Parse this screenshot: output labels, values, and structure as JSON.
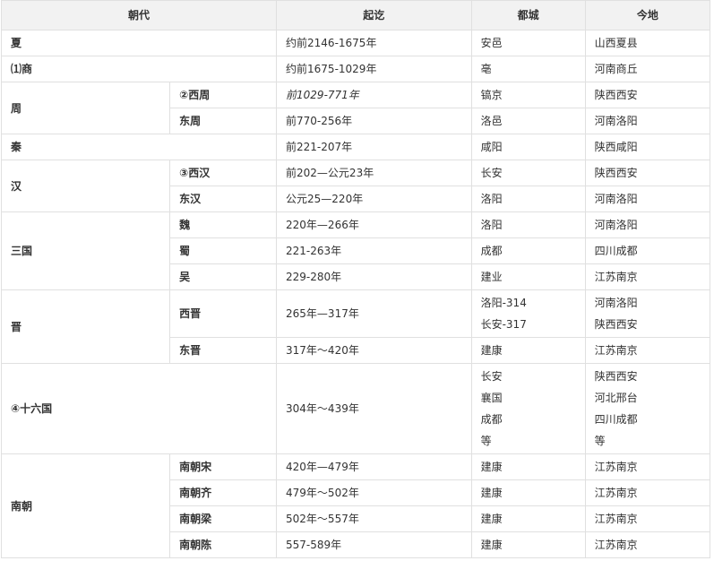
{
  "headers": [
    "朝代",
    "起讫",
    "都城",
    "今地"
  ],
  "rows": {
    "xia": {
      "dynasty": "夏",
      "period": "约前2146-1675年",
      "capital": "安邑",
      "location": "山西夏县"
    },
    "shang": {
      "dynasty": "⑴商",
      "period": "约前1675-1029年",
      "capital": "亳",
      "location": "河南商丘"
    },
    "zhou": {
      "dynasty": "周",
      "western": {
        "name": "②西周",
        "period": "前1029-771年",
        "capital": "镐京",
        "location": "陕西西安"
      },
      "eastern": {
        "name": "东周",
        "period": "前770-256年",
        "capital": "洛邑",
        "location": "河南洛阳"
      }
    },
    "qin": {
      "dynasty": "秦",
      "period": "前221-207年",
      "capital": "咸阳",
      "location": "陕西咸阳"
    },
    "han": {
      "dynasty": "汉",
      "western": {
        "name": "③西汉",
        "period": "前202—公元23年",
        "capital": "长安",
        "location": "陕西西安"
      },
      "eastern": {
        "name": "东汉",
        "period": "公元25—220年",
        "capital": "洛阳",
        "location": "河南洛阳"
      }
    },
    "three_kingdoms": {
      "dynasty": "三国",
      "wei": {
        "name": "魏",
        "period": "220年—266年",
        "capital": "洛阳",
        "location": "河南洛阳"
      },
      "shu": {
        "name": "蜀",
        "period": "221-263年",
        "capital": "成都",
        "location": "四川成都"
      },
      "wu": {
        "name": "吴",
        "period": "229-280年",
        "capital": "建业",
        "location": "江苏南京"
      }
    },
    "jin": {
      "dynasty": "晋",
      "western": {
        "name": "西晋",
        "period": "265年—317年",
        "capital_1": "洛阳-314",
        "capital_2": "长安-317",
        "location_1": "河南洛阳",
        "location_2": "陕西西安"
      },
      "eastern": {
        "name": "东晋",
        "period": "317年～420年",
        "capital": "建康",
        "location": "江苏南京"
      }
    },
    "sixteen": {
      "dynasty": "④十六国",
      "period": "304年～439年",
      "capitals": [
        "长安",
        "襄国",
        "成都",
        "等"
      ],
      "locations": [
        "陕西西安",
        "河北邢台",
        "四川成都",
        "等"
      ]
    },
    "southern": {
      "dynasty": "南朝",
      "song": {
        "name": "南朝宋",
        "period": "420年—479年",
        "capital": "建康",
        "location": "江苏南京"
      },
      "qi": {
        "name": "南朝齐",
        "period": "479年～502年",
        "capital": "建康",
        "location": "江苏南京"
      },
      "liang": {
        "name": "南朝梁",
        "period": "502年～557年",
        "capital": "建康",
        "location": "江苏南京"
      },
      "chen": {
        "name": "南朝陈",
        "period": "557-589年",
        "capital": "建康",
        "location": "江苏南京"
      }
    }
  }
}
